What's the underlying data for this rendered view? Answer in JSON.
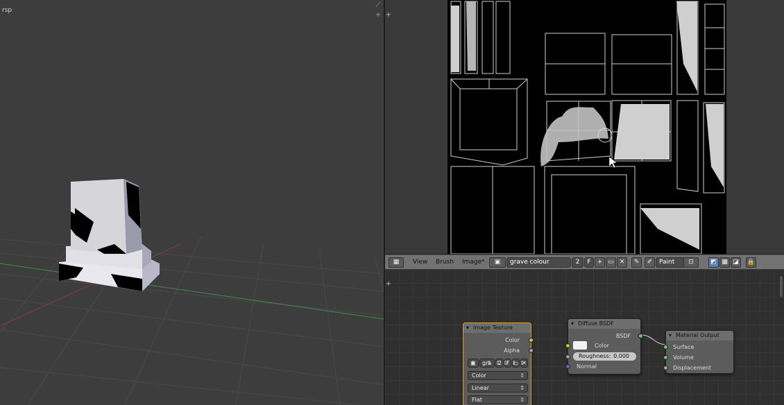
{
  "viewport": {
    "corner_label": "rsp"
  },
  "image_header": {
    "menus": [
      "View",
      "Brush",
      "Image*"
    ],
    "image_name": "grave colour",
    "users": "2",
    "fake_user": "F",
    "mode": "Paint"
  },
  "nodes": {
    "image_texture": {
      "title": "Image Texture",
      "outputs": [
        "Color",
        "Alpha"
      ],
      "image_short": "gra",
      "users": "2",
      "fake_user": "F",
      "color_space": "Color",
      "interpolation": "Linear",
      "projection": "Flat"
    },
    "diffuse": {
      "title": "Diffuse BSDF",
      "output": "BSDF",
      "color_label": "Color",
      "roughness_label": "Roughness:",
      "roughness_value": "0.000",
      "normal_label": "Normal"
    },
    "material_output": {
      "title": "Material Output",
      "inputs": [
        "Surface",
        "Volume",
        "Displacement"
      ]
    }
  },
  "colors": {
    "viewport_bg": "#3d3d3d",
    "uv_bg": "#000000",
    "header_bg": "#727272",
    "node_editor_bg": "#2f2f2f",
    "x_axis": "#8a3a3a",
    "y_axis": "#3f8f3f"
  }
}
